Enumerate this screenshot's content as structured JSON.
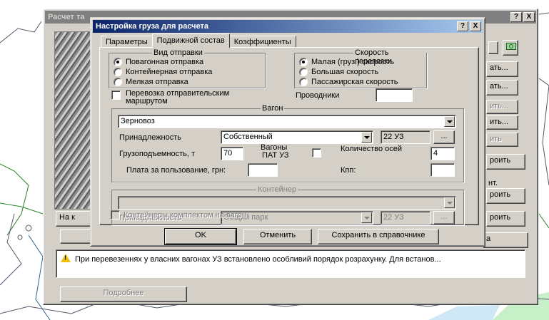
{
  "back_window": {
    "title": "Расчет та",
    "buttons_right": [
      "ать...",
      "ать...",
      "ить...",
      "ить...",
      "ить",
      "роить",
      "нт.",
      "роить",
      "роить"
    ],
    "tab_stub": "На к",
    "bottom_right_tab": "а",
    "warning_text": "При перевезеннях у власних вагонах УЗ встановлено особливий порядок розрахунку. Для встанов...",
    "details_button": "Подробнее"
  },
  "dialog": {
    "title": "Настройка груза для расчета",
    "title_buttons": [
      "?",
      "X"
    ],
    "tabs": [
      {
        "label": "Параметры",
        "active": false
      },
      {
        "label": "Подвижной состав",
        "active": true
      },
      {
        "label": "Коэффициенты",
        "active": false
      }
    ],
    "shipment_type": {
      "legend": "Вид отправки",
      "options": [
        {
          "label": "Повагонная отправка",
          "selected": true
        },
        {
          "label": "Контейнерная отправка",
          "selected": false
        },
        {
          "label": "Мелкая отправка",
          "selected": false
        }
      ]
    },
    "speed": {
      "legend": "Скорость перевозки",
      "options": [
        {
          "label": "Малая (груз.) скорость",
          "selected": true
        },
        {
          "label": "Большая скорость",
          "selected": false
        },
        {
          "label": "Пассажирская скорость",
          "selected": false
        }
      ]
    },
    "route_shipment": {
      "label_line1": "Перевозка отправительским",
      "label_line2": "маршрутом",
      "checked": false
    },
    "conductors": {
      "label": "Проводники",
      "value": ""
    },
    "wagon": {
      "legend": "Вагон",
      "type_value": "Зерновоз",
      "ownership_label": "Принадлежность",
      "ownership_value": "Собственный",
      "ownership_code": "22 УЗ",
      "ellipsis": "...",
      "capacity_label": "Грузоподъемность, т",
      "capacity_value": "70",
      "pat_label_line1": "Вагоны",
      "pat_label_line2": "ПАТ УЗ",
      "axles_label": "Количество осей",
      "axles_value": "4",
      "fee_label": "Плата за пользование, грн:",
      "fee_value": "",
      "kpp_label": "Кпп:",
      "kpp_value": ""
    },
    "container": {
      "legend": "Контейнер",
      "type_value": "",
      "ownership_label": "Принадлежность",
      "ownership_value": "Общий парк",
      "ownership_code": "22 УЗ",
      "ellipsis": "...",
      "kit_label": "Контейнеры комплектом на вагон"
    },
    "buttons": {
      "ok": "OK",
      "cancel": "Отменить",
      "save": "Сохранить в справочнике"
    }
  }
}
